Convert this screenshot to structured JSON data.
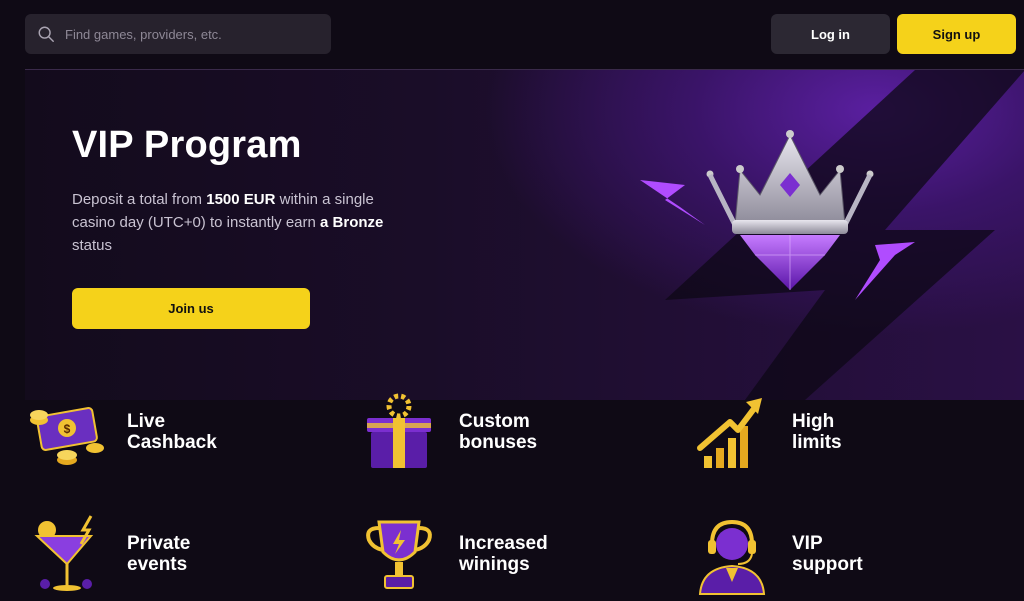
{
  "header": {
    "search_placeholder": "Find games, providers, etc.",
    "login_label": "Log in",
    "signup_label": "Sign up"
  },
  "hero": {
    "title": "VIP Program",
    "desc_1": "Deposit a total from ",
    "desc_amount": "1500 EUR",
    "desc_2": " within a single casino day (UTC+0) to instantly earn ",
    "desc_status": "a Bronze",
    "desc_3": " status",
    "join_label": "Join us"
  },
  "features": [
    {
      "label": "Live\nCashback",
      "icon": "cash-stack-icon"
    },
    {
      "label": "Custom\nbonuses",
      "icon": "gift-box-icon"
    },
    {
      "label": "High\nlimits",
      "icon": "rising-bars-icon"
    },
    {
      "label": "Private\nevents",
      "icon": "cocktail-icon"
    },
    {
      "label": "Increased\nwinings",
      "icon": "trophy-icon"
    },
    {
      "label": "VIP\nsupport",
      "icon": "headset-agent-icon"
    }
  ],
  "colors": {
    "accent": "#f5d21a",
    "purple": "#7b2fd0",
    "background": "#0f0a15"
  }
}
